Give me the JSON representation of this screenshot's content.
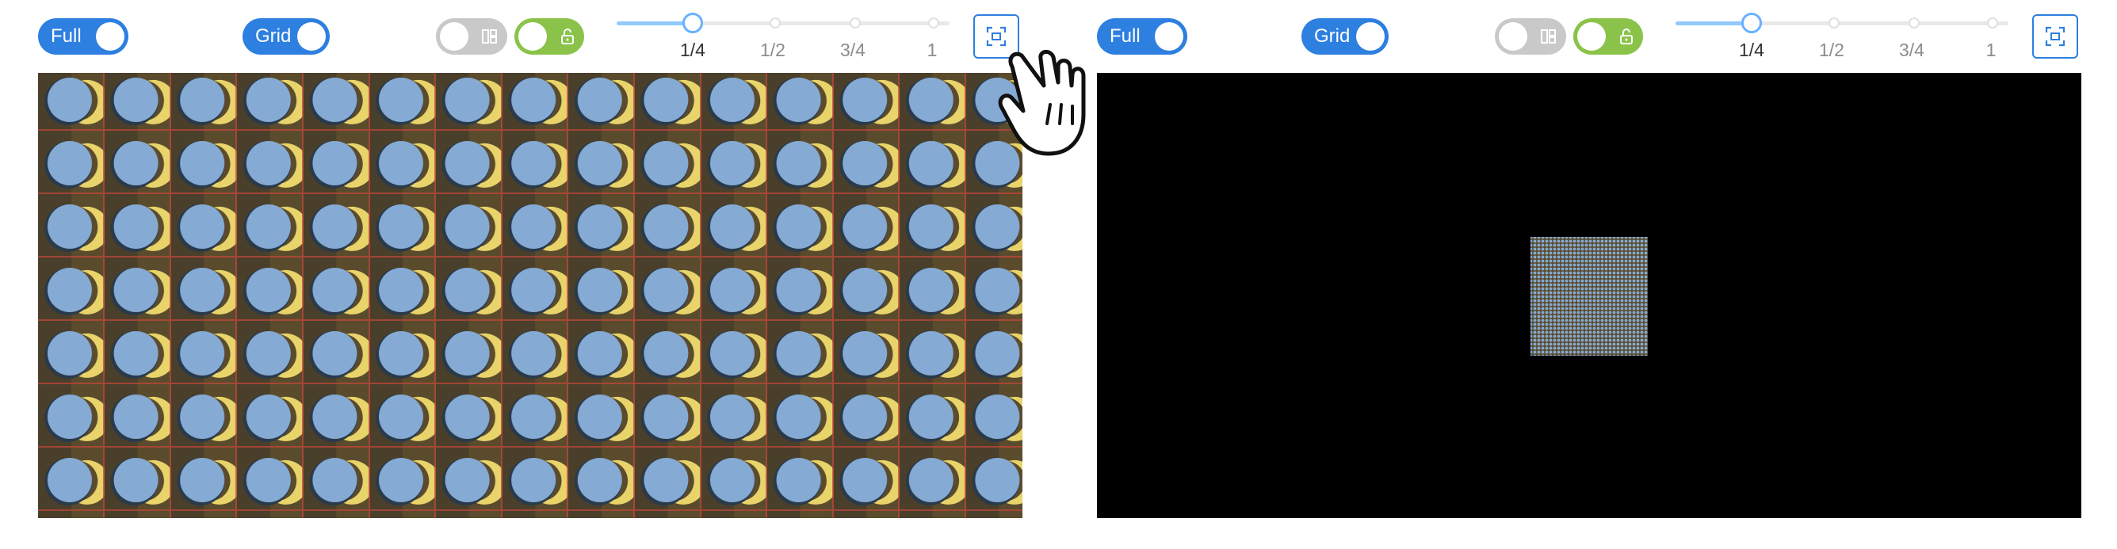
{
  "left_panel": {
    "full_toggle": {
      "label": "Full",
      "state": "on"
    },
    "grid_toggle": {
      "label": "Grid",
      "state": "on"
    },
    "layout_toggle": {
      "state": "off",
      "icon": "grid-layout-icon"
    },
    "lock_toggle": {
      "state": "on",
      "icon": "unlock-icon"
    },
    "zoom_slider": {
      "marks": [
        "1/4",
        "1/2",
        "3/4",
        "1"
      ],
      "selected": "1/4",
      "value_fraction": 0.25
    },
    "fit_button": {
      "icon": "fit-screen-icon"
    },
    "canvas": {
      "description_hidden": true
    }
  },
  "right_panel": {
    "full_toggle": {
      "label": "Full",
      "state": "on"
    },
    "grid_toggle": {
      "label": "Grid",
      "state": "on"
    },
    "layout_toggle": {
      "state": "off",
      "icon": "grid-layout-icon"
    },
    "lock_toggle": {
      "state": "on",
      "icon": "unlock-icon"
    },
    "zoom_slider": {
      "marks": [
        "1/4",
        "1/2",
        "3/4",
        "1"
      ],
      "selected": "1/4",
      "value_fraction": 0.25
    },
    "fit_button": {
      "icon": "fit-screen-icon"
    }
  },
  "cursor": {
    "icon": "hand-pointer-icon"
  },
  "colors": {
    "toggle_on": "#2d7fe0",
    "toggle_off": "#c9c9c9",
    "toggle_green": "#8bc34a",
    "circle_fill": "#85aad3",
    "canvas_bg": "#5b4b2d",
    "crescent": "#e8d46a",
    "grid_line": "#c0463a"
  }
}
